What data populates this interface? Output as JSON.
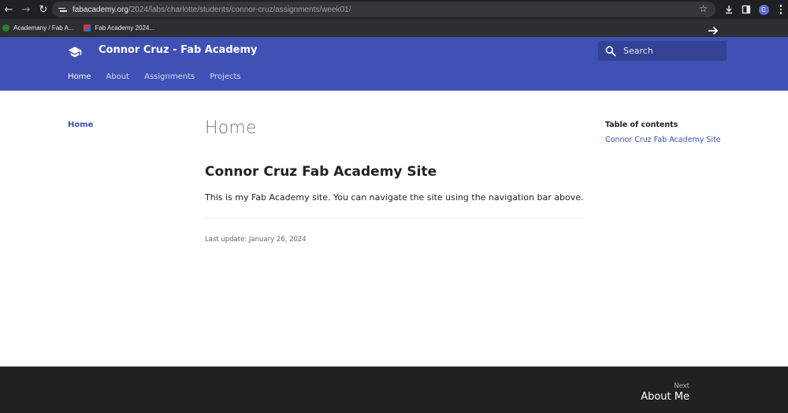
{
  "browser": {
    "url_host": "fabacademy.org",
    "url_path": "/2024/labs/charlotte/students/connor-cruz/assignments/week01/",
    "avatar_letter": "C",
    "bookmarks": [
      {
        "label": "Academany / Fab A..."
      },
      {
        "label": "Fab Academy 2024..."
      }
    ]
  },
  "header": {
    "site_title": "Connor Cruz - Fab Academy",
    "search_placeholder": "Search",
    "tabs": [
      {
        "label": "Home"
      },
      {
        "label": "About"
      },
      {
        "label": "Assignments"
      },
      {
        "label": "Projects"
      }
    ]
  },
  "sidebar": {
    "home_label": "Home"
  },
  "main": {
    "page_title": "Home",
    "section_title": "Connor Cruz Fab Academy Site",
    "body": "This is my Fab Academy site. You can navigate the site using the navigation bar above.",
    "last_update": "Last update: January 26, 2024"
  },
  "toc": {
    "title": "Table of contents",
    "links": [
      {
        "label": "Connor Cruz Fab Academy Site"
      }
    ]
  },
  "footer": {
    "next_label": "Next",
    "next_title": "About Me"
  },
  "colors": {
    "brand": "#3f51b5",
    "footer": "#212121",
    "chrome": "#202124"
  }
}
